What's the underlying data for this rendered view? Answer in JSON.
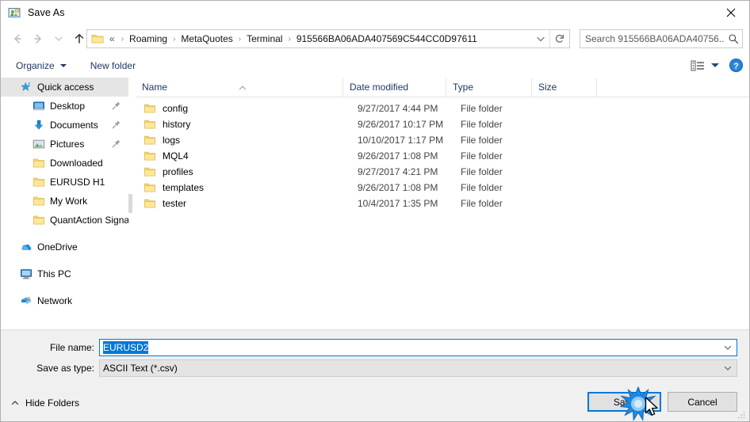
{
  "window": {
    "title": "Save As",
    "icon": "save-as-app-icon",
    "close_label": "✕"
  },
  "nav": {
    "back_icon": "arrow-left-icon",
    "forward_icon": "arrow-right-icon",
    "recent_icon": "chevron-down-icon",
    "up_icon": "arrow-up-icon",
    "address": {
      "folder_icon": "folder-icon",
      "lead": "«",
      "crumbs": [
        "Roaming",
        "MetaQuotes",
        "Terminal",
        "915566BA06ADA407569C544CC0D97611"
      ],
      "separator": "›",
      "dropdown_icon": "chevron-down-icon",
      "refresh_icon": "refresh-icon"
    },
    "search": {
      "placeholder": "Search 915566BA06ADA40756...",
      "icon": "search-icon"
    }
  },
  "commandbar": {
    "organize": "Organize",
    "new_folder": "New folder",
    "view_icon": "view-layout-icon",
    "help_icon": "help-icon"
  },
  "sidebar": {
    "items": [
      {
        "label": "Quick access",
        "icon": "star-pin-icon",
        "level": "root",
        "selected": true,
        "pinned": false
      },
      {
        "label": "Desktop",
        "icon": "desktop-icon",
        "level": "child",
        "selected": false,
        "pinned": true
      },
      {
        "label": "Documents",
        "icon": "documents-download-icon",
        "level": "child",
        "selected": false,
        "pinned": true
      },
      {
        "label": "Pictures",
        "icon": "pictures-icon",
        "level": "child",
        "selected": false,
        "pinned": true
      },
      {
        "label": "Downloaded",
        "icon": "folder-icon",
        "level": "child",
        "selected": false,
        "pinned": false
      },
      {
        "label": "EURUSD H1",
        "icon": "folder-icon",
        "level": "child",
        "selected": false,
        "pinned": false
      },
      {
        "label": "My Work",
        "icon": "folder-icon",
        "level": "child",
        "selected": false,
        "pinned": false
      },
      {
        "label": "QuantAction Signal",
        "icon": "folder-icon",
        "level": "child",
        "selected": false,
        "pinned": false
      },
      {
        "label": "OneDrive",
        "icon": "onedrive-cloud-icon",
        "level": "root",
        "selected": false,
        "pinned": false,
        "gap_before": true
      },
      {
        "label": "This PC",
        "icon": "this-pc-icon",
        "level": "root",
        "selected": false,
        "pinned": false,
        "gap_before": true
      },
      {
        "label": "Network",
        "icon": "network-icon",
        "level": "root",
        "selected": false,
        "pinned": false,
        "gap_before": true
      }
    ]
  },
  "filelist": {
    "columns": [
      "Name",
      "Date modified",
      "Type",
      "Size"
    ],
    "sort_column": "Name",
    "sort_direction": "ascending",
    "rows": [
      {
        "name": "config",
        "date": "9/27/2017 4:44 PM",
        "type": "File folder",
        "size": "",
        "icon": "folder-icon"
      },
      {
        "name": "history",
        "date": "9/26/2017 10:17 PM",
        "type": "File folder",
        "size": "",
        "icon": "folder-icon"
      },
      {
        "name": "logs",
        "date": "10/10/2017 1:17 PM",
        "type": "File folder",
        "size": "",
        "icon": "folder-icon"
      },
      {
        "name": "MQL4",
        "date": "9/26/2017 1:08 PM",
        "type": "File folder",
        "size": "",
        "icon": "folder-icon"
      },
      {
        "name": "profiles",
        "date": "9/27/2017 4:21 PM",
        "type": "File folder",
        "size": "",
        "icon": "folder-icon"
      },
      {
        "name": "templates",
        "date": "9/26/2017 1:08 PM",
        "type": "File folder",
        "size": "",
        "icon": "folder-icon"
      },
      {
        "name": "tester",
        "date": "10/4/2017 1:35 PM",
        "type": "File folder",
        "size": "",
        "icon": "folder-icon"
      }
    ]
  },
  "form": {
    "filename_label": "File name:",
    "filename_value": "EURUSD2",
    "filetype_label": "Save as type:",
    "filetype_value": "ASCII Text (*.csv)",
    "dropdown_icon": "chevron-down-icon"
  },
  "footer": {
    "hide_folders": "Hide Folders",
    "hide_folders_icon": "chevron-up-icon",
    "save": "Save",
    "cancel": "Cancel",
    "resize_grip_icon": "resize-grip-icon"
  },
  "overlay": {
    "click_burst_icon": "click-burst-icon",
    "cursor_icon": "mouse-cursor-icon",
    "accent_color": "#0078d7",
    "folder_color": "#ffd966"
  }
}
